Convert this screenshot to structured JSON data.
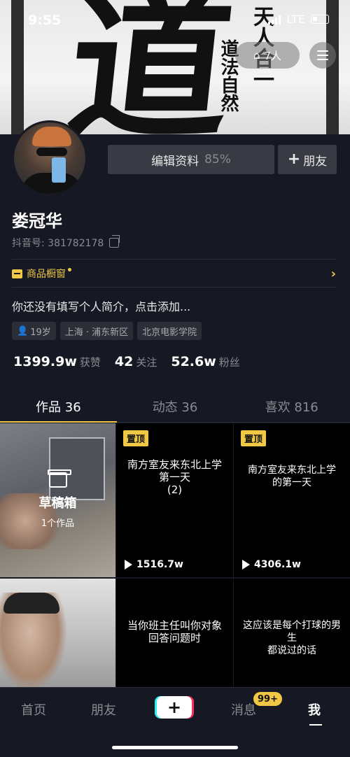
{
  "status_bar": {
    "time": "9:55",
    "network": "LTE"
  },
  "header": {
    "visitors_label": "7人"
  },
  "profile": {
    "name": "娄冠华",
    "douyin_id_label": "抖音号: 381782178",
    "edit_label": "编辑资料",
    "edit_percent": "85%",
    "add_friend_label": "朋友",
    "shop_label": "商品橱窗",
    "bio": "你还没有填写个人简介，点击添加...",
    "tags": {
      "age": "19岁",
      "location": "上海 · 浦东新区",
      "school": "北京电影学院"
    },
    "stats": {
      "likes_num": "1399.9w",
      "likes_label": "获赞",
      "following_num": "42",
      "following_label": "关注",
      "followers_num": "52.6w",
      "followers_label": "粉丝"
    }
  },
  "tabs": [
    {
      "label": "作品 36"
    },
    {
      "label": "动态 36"
    },
    {
      "label": "喜欢 816"
    }
  ],
  "grid": {
    "draft": {
      "title": "草稿箱",
      "count": "1个作品"
    },
    "videos": [
      {
        "pinned": "置顶",
        "title_line1": "南方室友来东北上学",
        "title_line2": "第一天",
        "title_line3": "(2)",
        "plays": "1516.7w"
      },
      {
        "pinned": "置顶",
        "title_line1": "南方室友来东北上学",
        "title_line2": "的第一天",
        "plays": "4306.1w"
      },
      {
        "title_line1": "当你班主任叫你对象",
        "title_line2": "回答问题时"
      },
      {
        "title_line1": "这应该是每个打球的男生",
        "title_line2": "都说过的话"
      }
    ]
  },
  "bottom_nav": {
    "home": "首页",
    "friends": "朋友",
    "messages": "消息",
    "me": "我",
    "messages_badge": "99+"
  },
  "colors": {
    "accent": "#f1c845",
    "background": "#161823"
  }
}
